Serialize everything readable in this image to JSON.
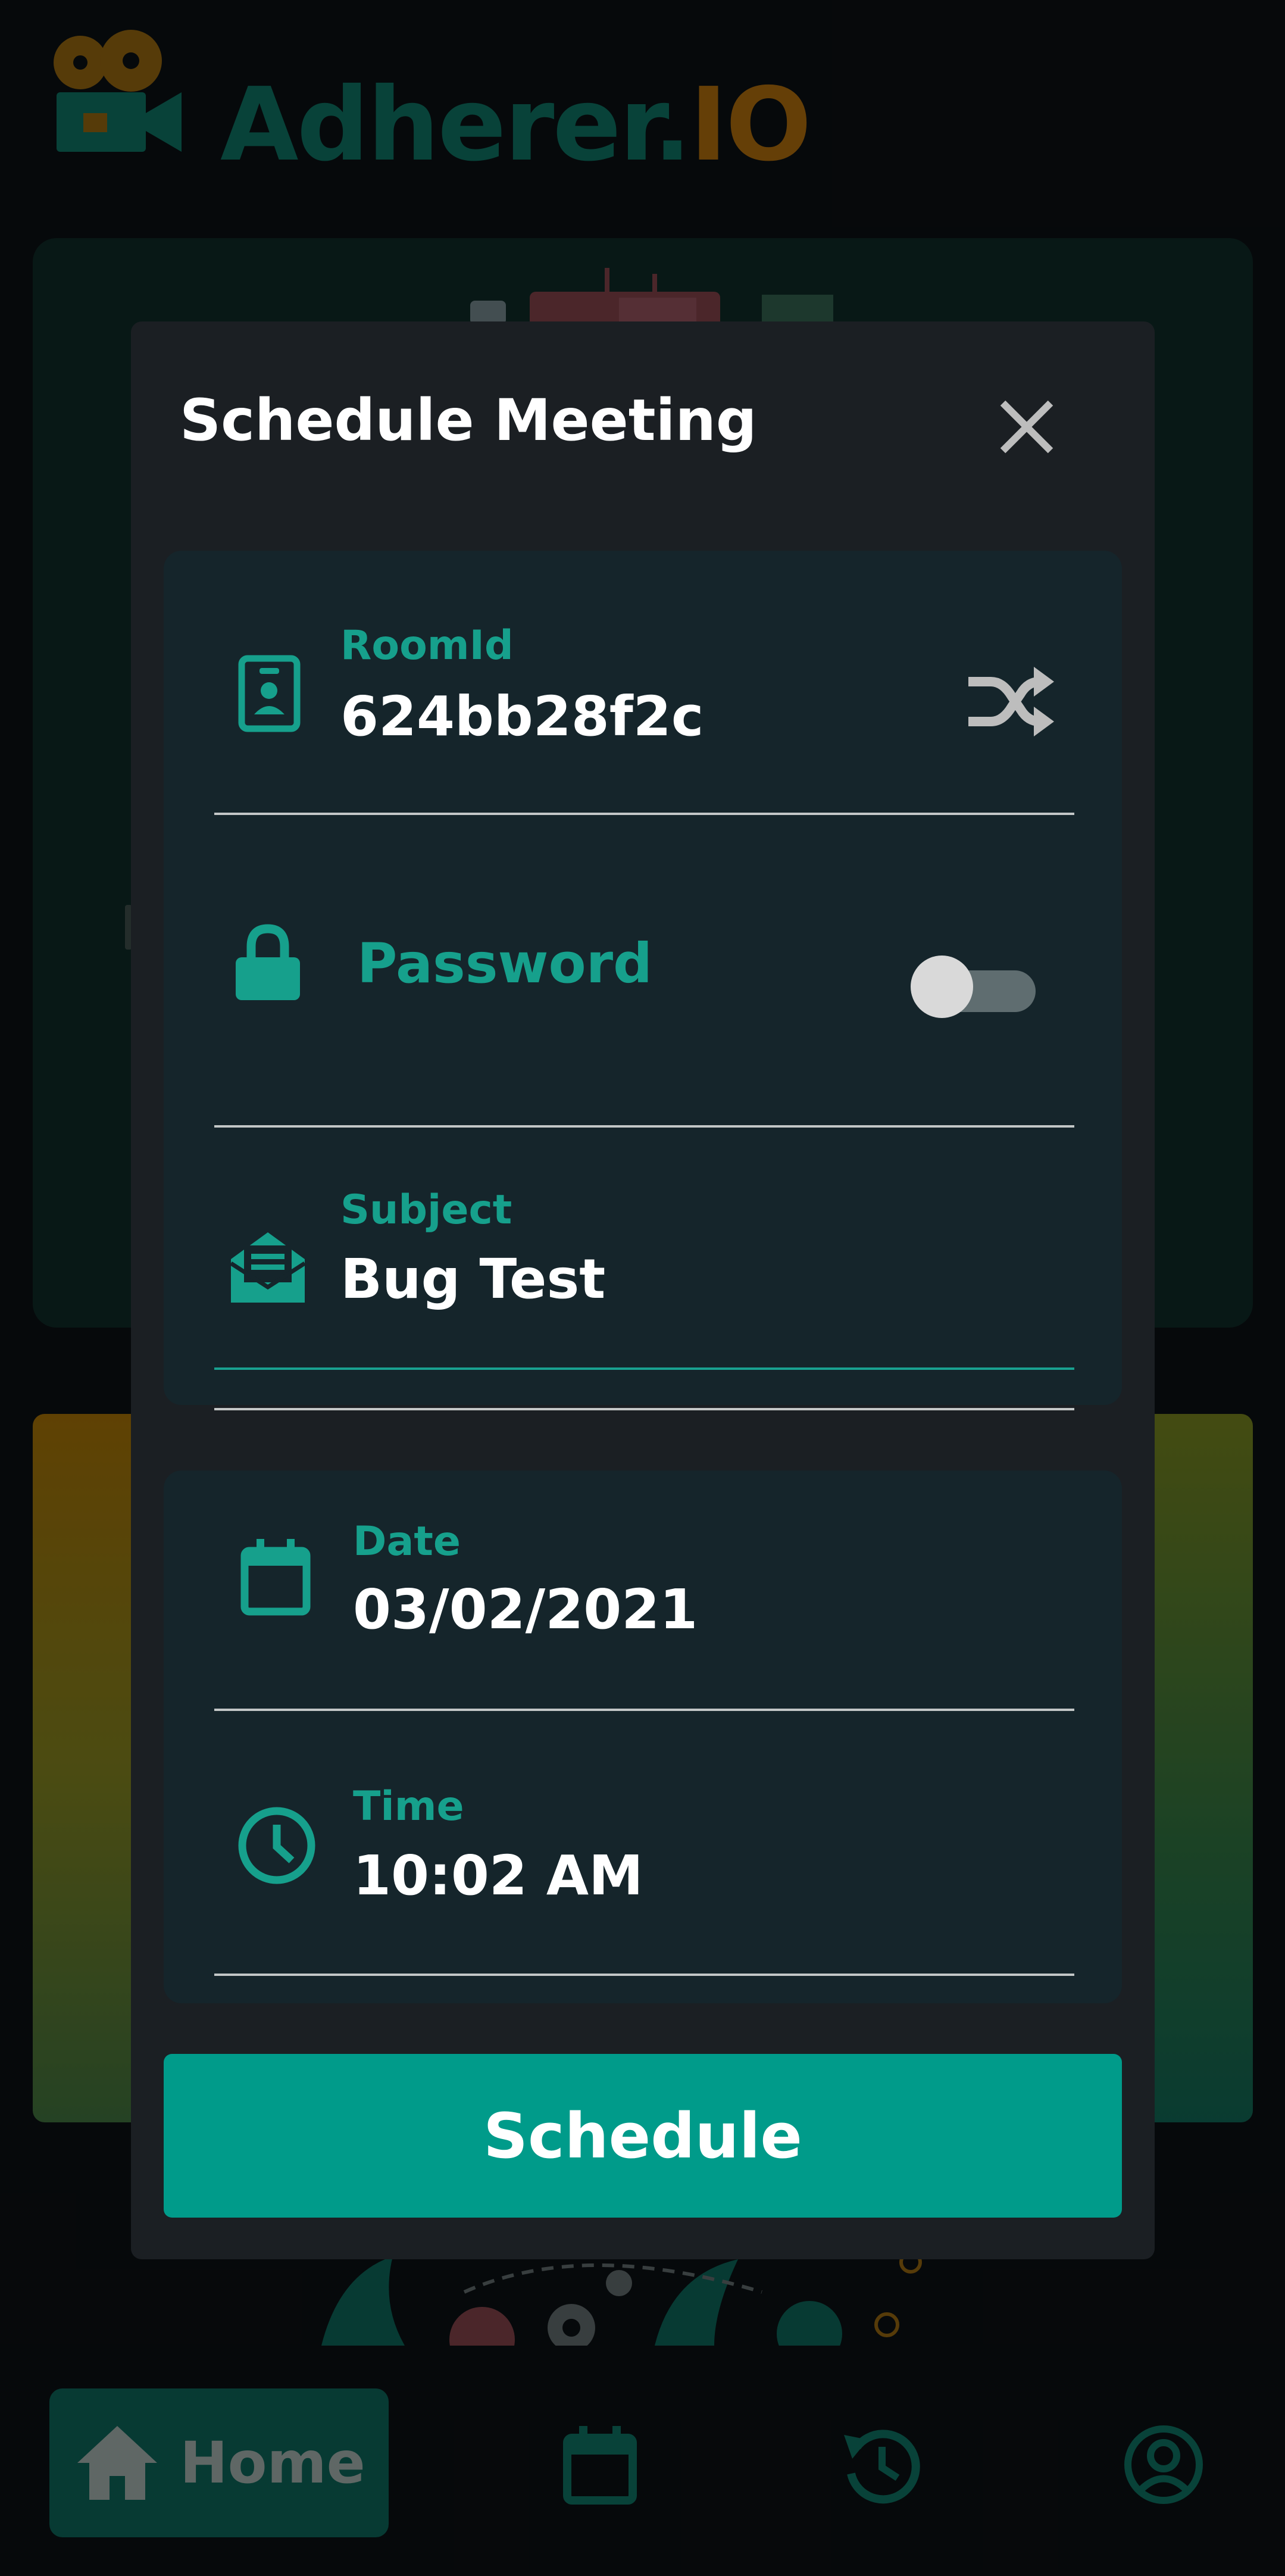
{
  "app": {
    "logo_part1": "Adherer.",
    "logo_part2": "IO"
  },
  "dialog": {
    "title": "Schedule Meeting",
    "room_id": {
      "label": "RoomId",
      "value": "624bb28f2c"
    },
    "password": {
      "label": "Password",
      "enabled": false
    },
    "subject": {
      "label": "Subject",
      "value": "Bug Test"
    },
    "date": {
      "label": "Date",
      "value": "03/02/2021"
    },
    "time": {
      "label": "Time",
      "value": "10:02 AM"
    },
    "submit_label": "Schedule"
  },
  "bottom_nav": {
    "home_label": "Home",
    "items": [
      "home-icon",
      "calendar-icon",
      "history-icon",
      "account-icon"
    ]
  },
  "colors": {
    "accent": "#009b8a",
    "accent_text": "#16a08c",
    "dialog_bg": "#1b1f23",
    "panel_bg": "#15252b"
  }
}
